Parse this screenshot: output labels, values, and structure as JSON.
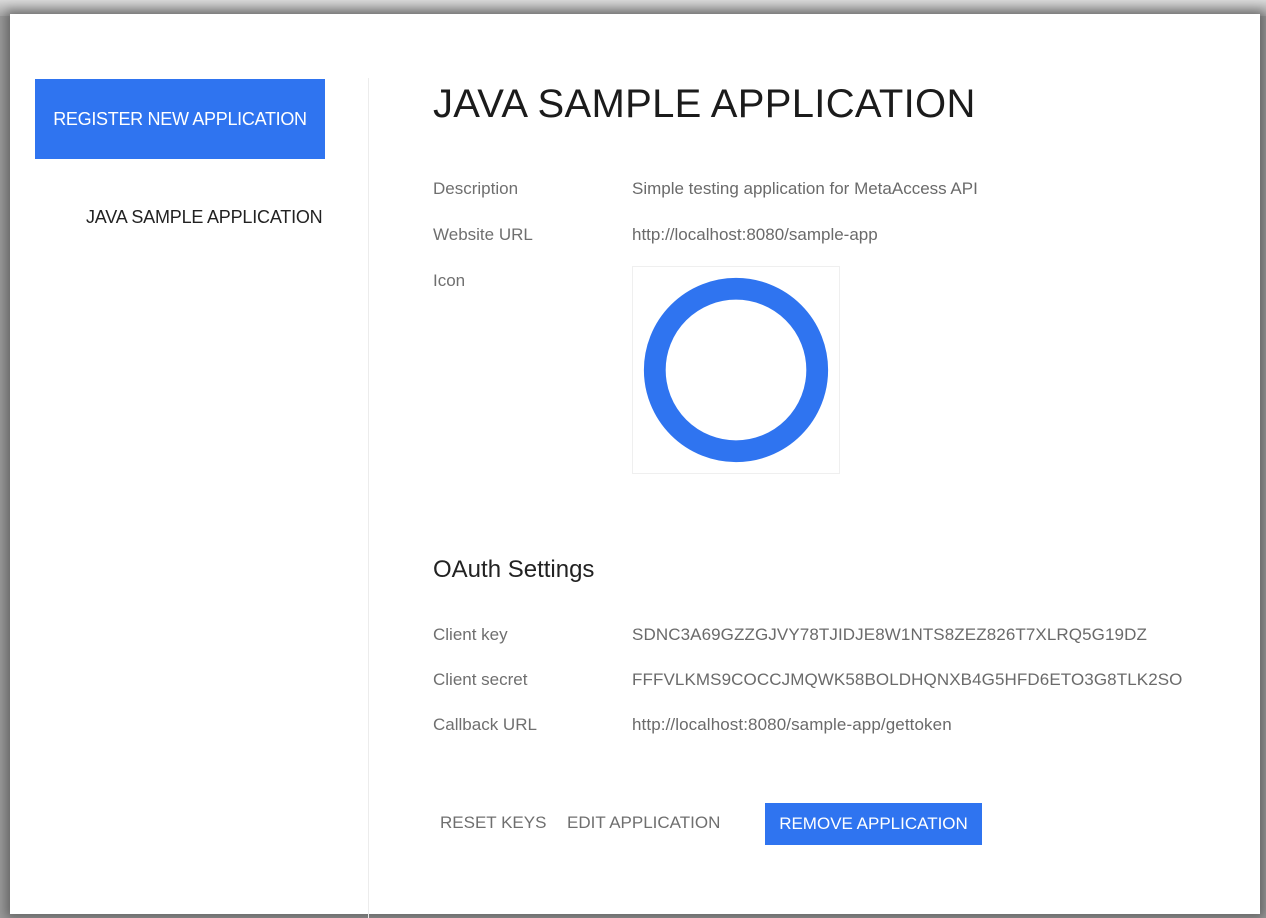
{
  "sidebar": {
    "register_label": "REGISTER NEW APPLICATION",
    "items": [
      {
        "label": "JAVA SAMPLE APPLICATION"
      }
    ]
  },
  "app": {
    "title": "JAVA SAMPLE APPLICATION",
    "fields": {
      "description": {
        "label": "Description",
        "value": "Simple testing application for MetaAccess API"
      },
      "website": {
        "label": "Website URL",
        "value": "http://localhost:8080/sample-app"
      },
      "icon": {
        "label": "Icon"
      }
    },
    "icon_color": "#2f74f0"
  },
  "oauth": {
    "title": "OAuth Settings",
    "client_key": {
      "label": "Client key",
      "value": "SDNC3A69GZZGJVY78TJIDJE8W1NTS8ZEZ826T7XLRQ5G19DZ"
    },
    "client_secret": {
      "label": "Client secret",
      "value": "FFFVLKMS9COCCJMQWK58BOLDHQNXB4G5HFD6ETO3G8TLK2SO"
    },
    "callback_url": {
      "label": "Callback URL",
      "value": "http://localhost:8080/sample-app/gettoken"
    }
  },
  "actions": {
    "reset_keys": "RESET KEYS",
    "edit_application": "EDIT APPLICATION",
    "remove_application": "REMOVE APPLICATION"
  },
  "colors": {
    "accent": "#2f74f0"
  }
}
